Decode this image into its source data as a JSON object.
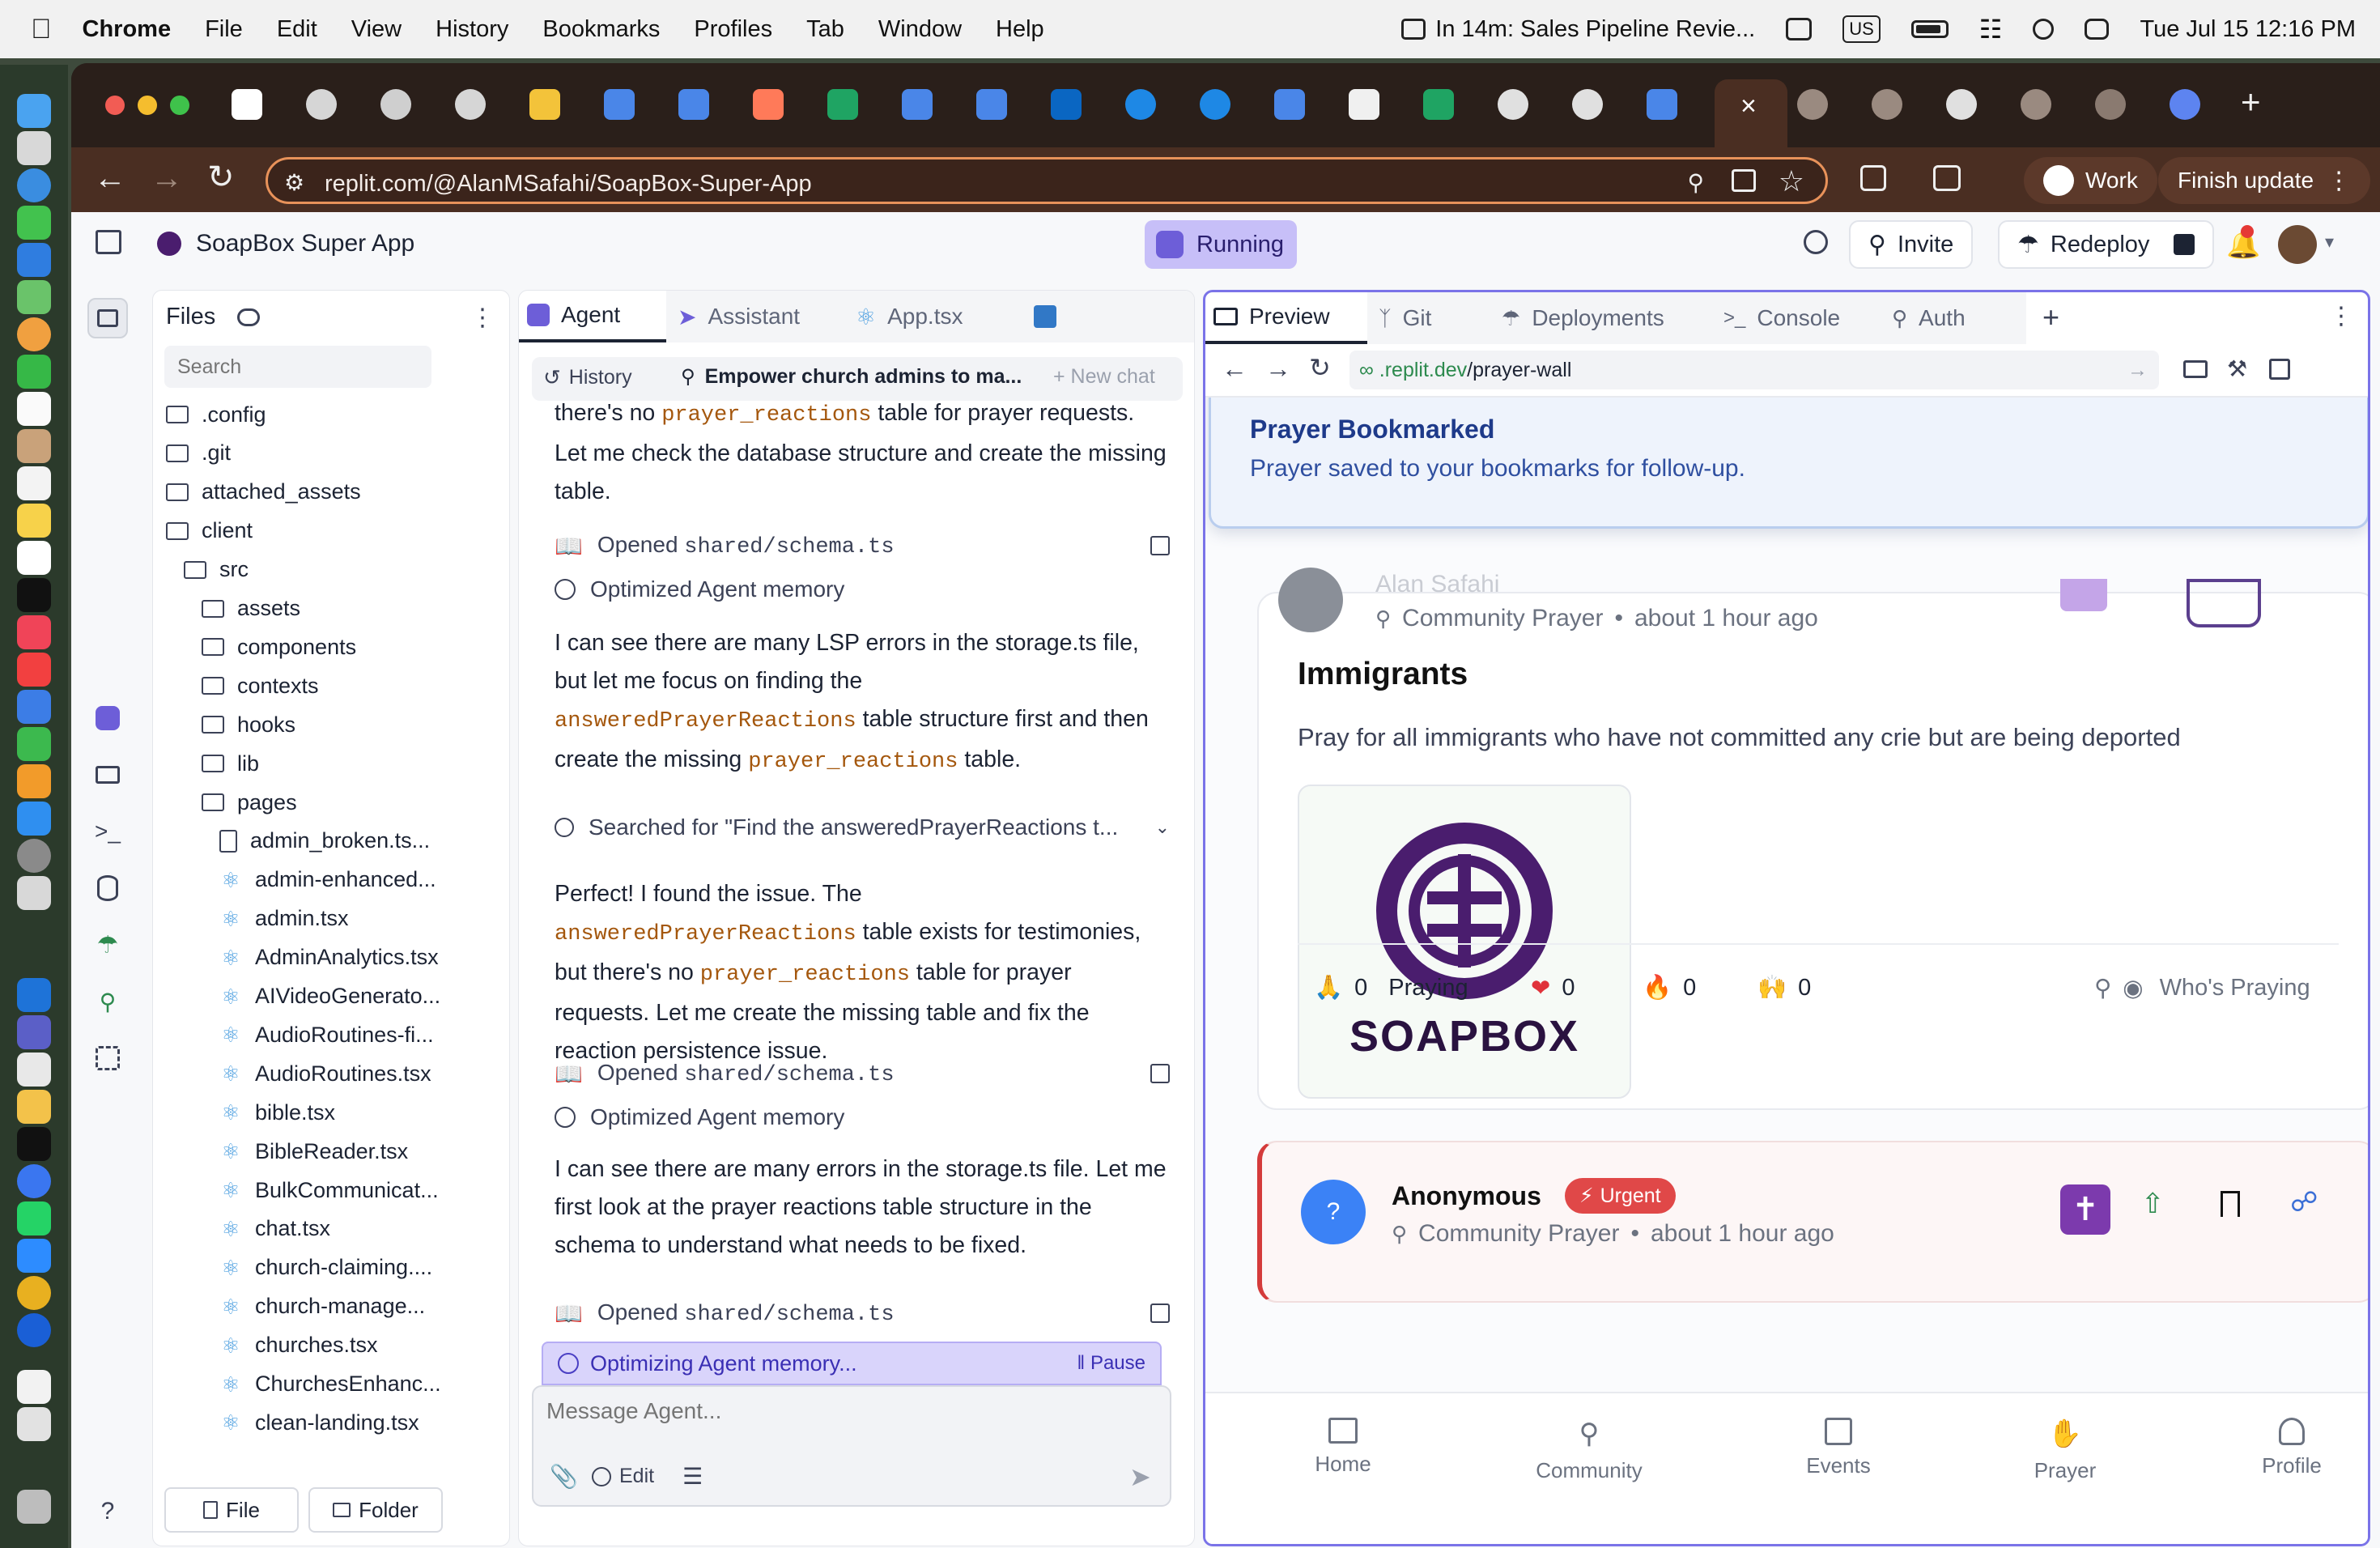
{
  "menubar": {
    "app": "Chrome",
    "items": [
      "File",
      "Edit",
      "View",
      "History",
      "Bookmarks",
      "Profiles",
      "Tab",
      "Window",
      "Help"
    ],
    "event": "In 14m: Sales Pipeline Revie...",
    "input_source": "US",
    "datetime": "Tue Jul 15  12:16 PM"
  },
  "browser": {
    "url": "replit.com/@AlanMSafahi/SoapBox-Super-App",
    "profile": "Work",
    "update": "Finish update"
  },
  "replit": {
    "app_name": "SoapBox Super App",
    "status": "Running",
    "invite": "Invite",
    "redeploy": "Redeploy"
  },
  "files": {
    "title": "Files",
    "search_placeholder": "Search",
    "tree": [
      {
        "name": ".config",
        "type": "folder",
        "depth": 0
      },
      {
        "name": ".git",
        "type": "folder",
        "depth": 0
      },
      {
        "name": "attached_assets",
        "type": "folder",
        "depth": 0
      },
      {
        "name": "client",
        "type": "folder",
        "depth": 0
      },
      {
        "name": "src",
        "type": "folder",
        "depth": 1
      },
      {
        "name": "assets",
        "type": "folder",
        "depth": 2
      },
      {
        "name": "components",
        "type": "folder",
        "depth": 2
      },
      {
        "name": "contexts",
        "type": "folder",
        "depth": 2
      },
      {
        "name": "hooks",
        "type": "folder",
        "depth": 2
      },
      {
        "name": "lib",
        "type": "folder",
        "depth": 2
      },
      {
        "name": "pages",
        "type": "folder",
        "depth": 2
      },
      {
        "name": "admin_broken.ts...",
        "type": "file",
        "depth": 3
      },
      {
        "name": "admin-enhanced...",
        "type": "react",
        "depth": 3
      },
      {
        "name": "admin.tsx",
        "type": "react",
        "depth": 3
      },
      {
        "name": "AdminAnalytics.tsx",
        "type": "react",
        "depth": 3
      },
      {
        "name": "AIVideoGenerato...",
        "type": "react",
        "depth": 3
      },
      {
        "name": "AudioRoutines-fi...",
        "type": "react",
        "depth": 3
      },
      {
        "name": "AudioRoutines.tsx",
        "type": "react",
        "depth": 3
      },
      {
        "name": "bible.tsx",
        "type": "react",
        "depth": 3
      },
      {
        "name": "BibleReader.tsx",
        "type": "react",
        "depth": 3
      },
      {
        "name": "BulkCommunicat...",
        "type": "react",
        "depth": 3
      },
      {
        "name": "chat.tsx",
        "type": "react",
        "depth": 3
      },
      {
        "name": "church-claiming....",
        "type": "react",
        "depth": 3
      },
      {
        "name": "church-manage...",
        "type": "react",
        "depth": 3
      },
      {
        "name": "churches.tsx",
        "type": "react",
        "depth": 3
      },
      {
        "name": "ChurchesEnhanc...",
        "type": "react",
        "depth": 3
      },
      {
        "name": "clean-landing.tsx",
        "type": "react",
        "depth": 3
      }
    ],
    "new_file": "File",
    "new_folder": "Folder"
  },
  "agent": {
    "tabs": [
      "Agent",
      "Assistant",
      "App.tsx"
    ],
    "history": "History",
    "thread": "Empower church admins to ma...",
    "new_chat": "New chat",
    "p0_a": "there's no ",
    "p0_code": "prayer_reactions",
    "p0_b": " table for prayer requests. Let me check the database structure and create the missing table.",
    "t1_pre": "Opened ",
    "t1_file": "shared/schema.ts",
    "t2": "Optimized Agent memory",
    "p1_a": "I can see there are many LSP errors in the storage.ts file, but let me focus on finding the ",
    "p1_code1": "answeredPrayerReactions",
    "p1_b": " table structure first and then create the missing ",
    "p1_code2": "prayer_reactions",
    "p1_c": " table.",
    "t3": "Searched for \"Find the answeredPrayerReactions t...",
    "p2_a": "Perfect! I found the issue. The ",
    "p2_code1": "answeredPrayerReactions",
    "p2_b": " table exists for testimonies, but there's no ",
    "p2_code2": "prayer_reactions",
    "p2_c": " table for prayer requests. Let me create the missing table and fix the reaction persistence issue.",
    "t4_pre": "Opened ",
    "t4_file": "shared/schema.ts",
    "t5": "Optimized Agent memory",
    "p3": "I can see there are many errors in the storage.ts file. Let me first look at the prayer reactions table structure in the schema to understand what needs to be fixed.",
    "t6_pre": "Opened ",
    "t6_file": "shared/schema.ts",
    "progress": "Optimizing Agent memory...",
    "pause": "Pause",
    "message_placeholder": "Message Agent...",
    "edit": "Edit"
  },
  "preview": {
    "tabs": [
      "Preview",
      "Git",
      "Deployments",
      "Console",
      "Auth"
    ],
    "url_host": ".replit.dev",
    "url_path": "/prayer-wall",
    "toast_title": "Prayer Bookmarked",
    "toast_body": "Prayer saved to your bookmarks for follow-up.",
    "post1": {
      "author": "Alan Safahi",
      "category": "Community Prayer",
      "time": "about 1 hour ago",
      "title": "Immigrants",
      "body": "Pray for all immigrants who have not committed any crie but are being deported",
      "logo_text": "SOAPBOX",
      "praying_count": "0",
      "praying_label": "Praying",
      "heart_count": "0",
      "fire_count": "0",
      "hands_count": "0",
      "whos_praying": "Who's Praying"
    },
    "post2": {
      "avatar": "?",
      "author": "Anonymous",
      "badge": "Urgent",
      "category": "Community Prayer",
      "time": "about 1 hour ago"
    },
    "nav": [
      "Home",
      "Community",
      "Events",
      "Prayer",
      "Profile"
    ]
  },
  "colors": {
    "accent": "#7a73e8",
    "code": "#a4570d",
    "urgent": "#e04848",
    "brand": "#4a1d6e",
    "link_green": "#2d8a4e"
  }
}
